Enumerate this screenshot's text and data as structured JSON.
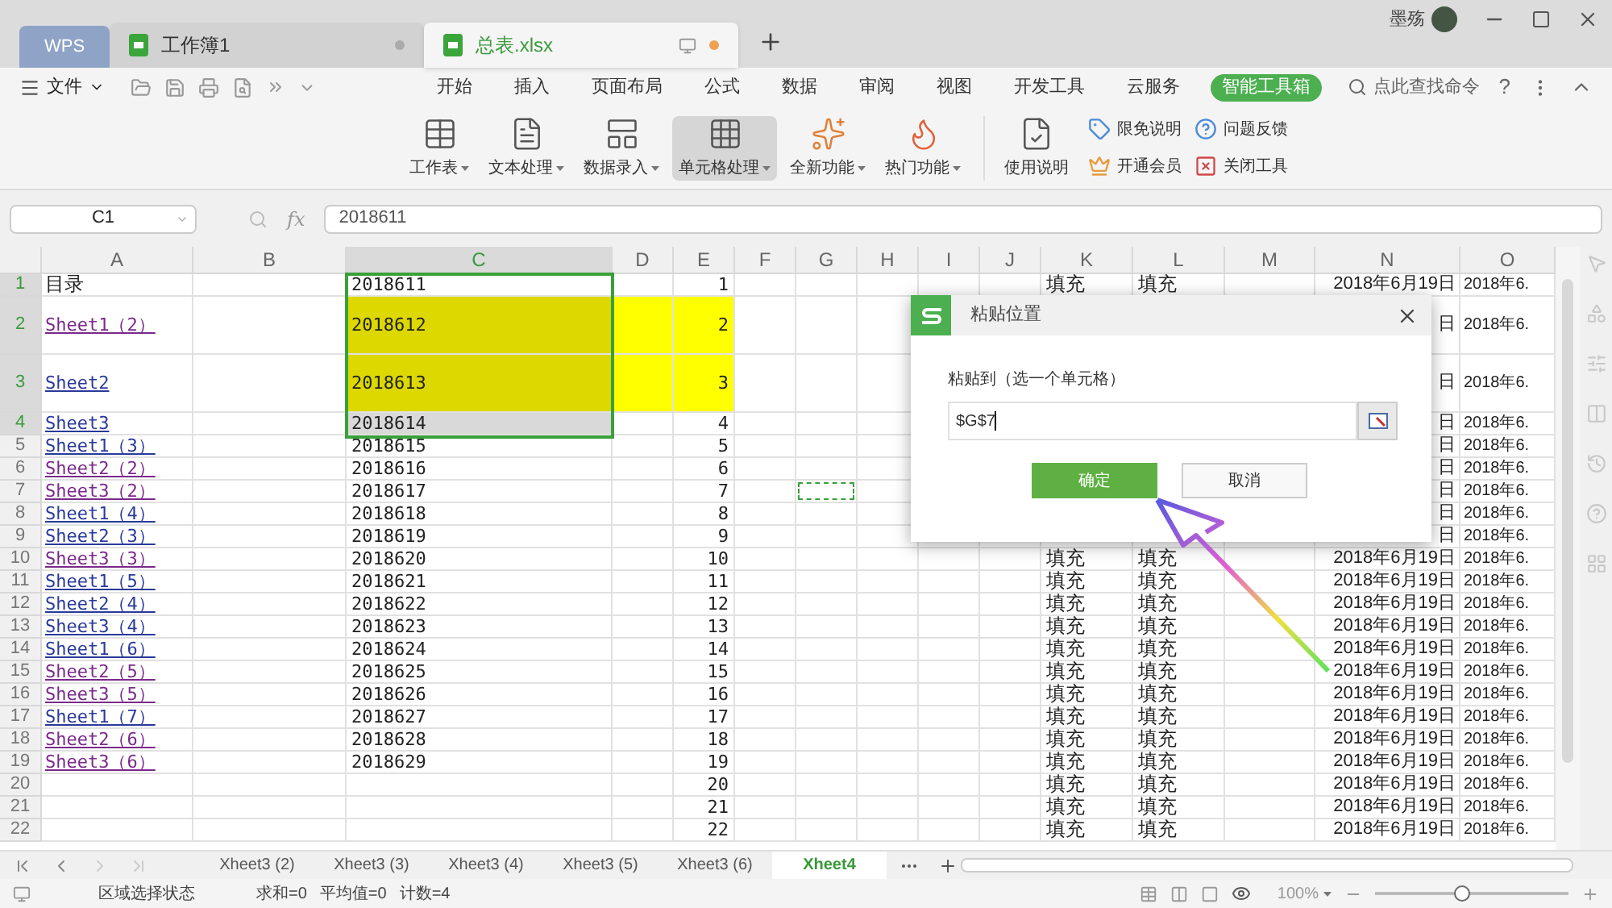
{
  "title_tabs": [
    {
      "kind": "brand",
      "label": "WPS",
      "selected": false
    },
    {
      "kind": "doc",
      "label": "工作簿1",
      "selected": false
    },
    {
      "kind": "doc",
      "label": "总表.xlsx",
      "selected": true
    }
  ],
  "user": {
    "name": "墨殇"
  },
  "menu": {
    "file": "文件",
    "tabs": [
      {
        "label": "开始",
        "selected": false
      },
      {
        "label": "插入",
        "selected": false
      },
      {
        "label": "页面布局",
        "selected": false
      },
      {
        "label": "公式",
        "selected": false
      },
      {
        "label": "数据",
        "selected": false
      },
      {
        "label": "审阅",
        "selected": false
      },
      {
        "label": "视图",
        "selected": false
      },
      {
        "label": "开发工具",
        "selected": false
      },
      {
        "label": "云服务",
        "selected": false
      },
      {
        "label": "智能工具箱",
        "selected": true
      }
    ],
    "search": "点此查找命令",
    "help": "?"
  },
  "ribbon": {
    "big": [
      {
        "label": "工作表",
        "kind": "sheet",
        "pressed": false
      },
      {
        "label": "文本处理",
        "kind": "text",
        "pressed": false
      },
      {
        "label": "数据录入",
        "kind": "entry",
        "pressed": false
      },
      {
        "label": "单元格处理",
        "kind": "cell",
        "pressed": true
      },
      {
        "label": "全新功能",
        "kind": "new",
        "pressed": false
      },
      {
        "label": "热门功能",
        "kind": "hot",
        "pressed": false
      }
    ],
    "guide": "使用说明",
    "small": [
      {
        "label": "限免说明",
        "kind": "tag"
      },
      {
        "label": "开通会员",
        "kind": "crown"
      },
      {
        "label": "问题反馈",
        "kind": "question"
      },
      {
        "label": "关闭工具",
        "kind": "close"
      }
    ]
  },
  "formula_bar": {
    "name_box": "C1",
    "fx": "fx",
    "value": "2018611"
  },
  "columns": [
    {
      "label": "A",
      "selected": false
    },
    {
      "label": "B",
      "selected": false
    },
    {
      "label": "C",
      "selected": true
    },
    {
      "label": "D",
      "selected": false
    },
    {
      "label": "E",
      "selected": false
    },
    {
      "label": "F",
      "selected": false
    },
    {
      "label": "G",
      "selected": false
    },
    {
      "label": "H",
      "selected": false
    },
    {
      "label": "I",
      "selected": false
    },
    {
      "label": "J",
      "selected": false
    },
    {
      "label": "K",
      "selected": false
    },
    {
      "label": "L",
      "selected": false
    },
    {
      "label": "M",
      "selected": false
    },
    {
      "label": "N",
      "selected": false
    },
    {
      "label": "O",
      "selected": false
    }
  ],
  "rows": [
    {
      "num": "1",
      "a": "目录",
      "a_link": false,
      "a_visited": false,
      "c": "2018611",
      "c_selected": true,
      "active": true,
      "highlighted": false,
      "tall": false,
      "e": "1",
      "k": "填充",
      "l": "填充",
      "n": "2018年6月19日",
      "o": "2018年6.",
      "marquee": false
    },
    {
      "num": "2",
      "a": "Sheet1（2）",
      "a_link": true,
      "a_visited": true,
      "c": "2018612",
      "c_selected": true,
      "active": false,
      "highlighted": true,
      "tall": true,
      "e": "2",
      "n": "日",
      "o": "2018年6.",
      "marquee": false
    },
    {
      "num": "3",
      "a": "Sheet2",
      "a_link": true,
      "a_visited": false,
      "c": "2018613",
      "c_selected": true,
      "active": false,
      "highlighted": true,
      "tall": true,
      "e": "3",
      "n": "日",
      "o": "2018年6.",
      "marquee": false
    },
    {
      "num": "4",
      "a": "Sheet3",
      "a_link": true,
      "a_visited": false,
      "c": "2018614",
      "c_selected": true,
      "active": false,
      "highlighted": false,
      "tall": false,
      "e": "4",
      "n": "日",
      "o": "2018年6.",
      "marquee": false
    },
    {
      "num": "5",
      "a": "Sheet1（3）",
      "a_link": true,
      "a_visited": false,
      "c": "2018615",
      "c_selected": false,
      "active": false,
      "highlighted": false,
      "tall": false,
      "e": "5",
      "n": "日",
      "o": "2018年6.",
      "marquee": false
    },
    {
      "num": "6",
      "a": "Sheet2（2）",
      "a_link": true,
      "a_visited": true,
      "c": "2018616",
      "c_selected": false,
      "active": false,
      "highlighted": false,
      "tall": false,
      "e": "6",
      "n": "日",
      "o": "2018年6.",
      "marquee": false
    },
    {
      "num": "7",
      "a": "Sheet3（2）",
      "a_link": true,
      "a_visited": true,
      "c": "2018617",
      "c_selected": false,
      "active": false,
      "highlighted": false,
      "tall": false,
      "e": "7",
      "n": "日",
      "o": "2018年6.",
      "marquee": true
    },
    {
      "num": "8",
      "a": "Sheet1（4）",
      "a_link": true,
      "a_visited": false,
      "c": "2018618",
      "c_selected": false,
      "active": false,
      "highlighted": false,
      "tall": false,
      "e": "8",
      "n": "日",
      "o": "2018年6.",
      "marquee": false
    },
    {
      "num": "9",
      "a": "Sheet2（3）",
      "a_link": true,
      "a_visited": false,
      "c": "2018619",
      "c_selected": false,
      "active": false,
      "highlighted": false,
      "tall": false,
      "e": "9",
      "n": "日",
      "o": "2018年6.",
      "marquee": false
    },
    {
      "num": "10",
      "a": "Sheet3（3）",
      "a_link": true,
      "a_visited": true,
      "c": "2018620",
      "c_selected": false,
      "active": false,
      "highlighted": false,
      "tall": false,
      "e": "10",
      "k": "填充",
      "l": "填充",
      "n": "2018年6月19日",
      "o": "2018年6.",
      "marquee": false
    },
    {
      "num": "11",
      "a": "Sheet1（5）",
      "a_link": true,
      "a_visited": false,
      "c": "2018621",
      "c_selected": false,
      "active": false,
      "highlighted": false,
      "tall": false,
      "e": "11",
      "k": "填充",
      "l": "填充",
      "n": "2018年6月19日",
      "o": "2018年6.",
      "marquee": false
    },
    {
      "num": "12",
      "a": "Sheet2（4）",
      "a_link": true,
      "a_visited": false,
      "c": "2018622",
      "c_selected": false,
      "active": false,
      "highlighted": false,
      "tall": false,
      "e": "12",
      "k": "填充",
      "l": "填充",
      "n": "2018年6月19日",
      "o": "2018年6.",
      "marquee": false
    },
    {
      "num": "13",
      "a": "Sheet3（4）",
      "a_link": true,
      "a_visited": false,
      "c": "2018623",
      "c_selected": false,
      "active": false,
      "highlighted": false,
      "tall": false,
      "e": "13",
      "k": "填充",
      "l": "填充",
      "n": "2018年6月19日",
      "o": "2018年6.",
      "marquee": false
    },
    {
      "num": "14",
      "a": "Sheet1（6）",
      "a_link": true,
      "a_visited": false,
      "c": "2018624",
      "c_selected": false,
      "active": false,
      "highlighted": false,
      "tall": false,
      "e": "14",
      "k": "填充",
      "l": "填充",
      "n": "2018年6月19日",
      "o": "2018年6.",
      "marquee": false
    },
    {
      "num": "15",
      "a": "Sheet2（5）",
      "a_link": true,
      "a_visited": true,
      "c": "2018625",
      "c_selected": false,
      "active": false,
      "highlighted": false,
      "tall": false,
      "e": "15",
      "k": "填充",
      "l": "填充",
      "n": "2018年6月19日",
      "o": "2018年6.",
      "marquee": false
    },
    {
      "num": "16",
      "a": "Sheet3（5）",
      "a_link": true,
      "a_visited": true,
      "c": "2018626",
      "c_selected": false,
      "active": false,
      "highlighted": false,
      "tall": false,
      "e": "16",
      "k": "填充",
      "l": "填充",
      "n": "2018年6月19日",
      "o": "2018年6.",
      "marquee": false
    },
    {
      "num": "17",
      "a": "Sheet1（7）",
      "a_link": true,
      "a_visited": false,
      "c": "2018627",
      "c_selected": false,
      "active": false,
      "highlighted": false,
      "tall": false,
      "e": "17",
      "k": "填充",
      "l": "填充",
      "n": "2018年6月19日",
      "o": "2018年6.",
      "marquee": false
    },
    {
      "num": "18",
      "a": "Sheet2（6）",
      "a_link": true,
      "a_visited": true,
      "c": "2018628",
      "c_selected": false,
      "active": false,
      "highlighted": false,
      "tall": false,
      "e": "18",
      "k": "填充",
      "l": "填充",
      "n": "2018年6月19日",
      "o": "2018年6.",
      "marquee": false
    },
    {
      "num": "19",
      "a": "Sheet3（6）",
      "a_link": true,
      "a_visited": true,
      "c": "2018629",
      "c_selected": false,
      "active": false,
      "highlighted": false,
      "tall": false,
      "e": "19",
      "k": "填充",
      "l": "填充",
      "n": "2018年6月19日",
      "o": "2018年6.",
      "marquee": false
    },
    {
      "num": "20",
      "c_selected": false,
      "active": false,
      "highlighted": false,
      "tall": false,
      "e": "20",
      "k": "填充",
      "l": "填充",
      "n": "2018年6月19日",
      "o": "2018年6.",
      "marquee": false
    },
    {
      "num": "21",
      "c_selected": false,
      "active": false,
      "highlighted": false,
      "tall": false,
      "e": "21",
      "k": "填充",
      "l": "填充",
      "n": "2018年6月19日",
      "o": "2018年6.",
      "marquee": false
    },
    {
      "num": "22",
      "c_selected": false,
      "active": false,
      "highlighted": false,
      "tall": false,
      "e": "22",
      "k": "填充",
      "l": "填充",
      "n": "2018年6月19日",
      "o": "2018年6.",
      "marquee": false
    }
  ],
  "dialog": {
    "title": "粘贴位置",
    "label": "粘贴到（选一个单元格）",
    "value": "$G$7",
    "ok": "确定",
    "cancel": "取消"
  },
  "sheet_tabs": [
    {
      "label": "Xheet3 (2)",
      "selected": false
    },
    {
      "label": "Xheet3 (3)",
      "selected": false
    },
    {
      "label": "Xheet3 (4)",
      "selected": false
    },
    {
      "label": "Xheet3 (5)",
      "selected": false
    },
    {
      "label": "Xheet3 (6)",
      "selected": false
    },
    {
      "label": "Xheet4",
      "selected": true
    }
  ],
  "status_bar": {
    "mode": "区域选择状态",
    "stats": [
      "求和=0",
      "平均值=0",
      "计数=4"
    ],
    "zoom": "100%",
    "zoom_slider": {
      "level": 0.45
    }
  }
}
